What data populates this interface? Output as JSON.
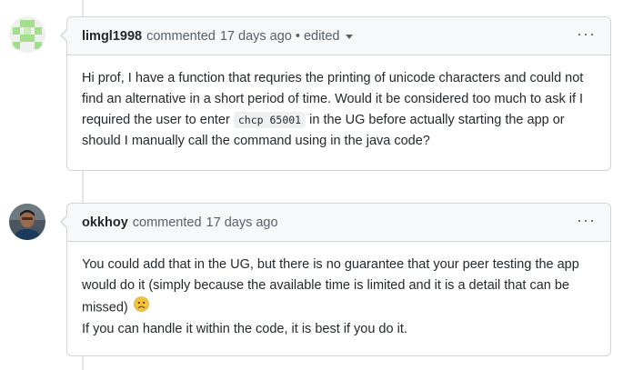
{
  "comments": [
    {
      "author": "limgl1998",
      "verb": "commented",
      "time": "17 days ago",
      "separator": "•",
      "edited": "edited",
      "more_label": "···",
      "body": {
        "before_code": "Hi prof, I have a function that requries the printing of unicode characters and could not find an alternative in a short period of time. Would it be considered too much to ask if I required the user to enter",
        "code": "chcp 65001",
        "after_code": "in the UG before actually starting the app or should I manually call the command using in the java code?"
      }
    },
    {
      "author": "okkhoy",
      "verb": "commented",
      "time": "17 days ago",
      "more_label": "···",
      "body": {
        "line1": "You could add that in the UG, but there is no guarantee that your peer testing the app would do it (simply because the available time is limited and it is a detail that can be missed)",
        "emoji_icon": "frowning-face-icon",
        "line2": "If you can handle it within the code, it is best if you do it."
      }
    }
  ]
}
